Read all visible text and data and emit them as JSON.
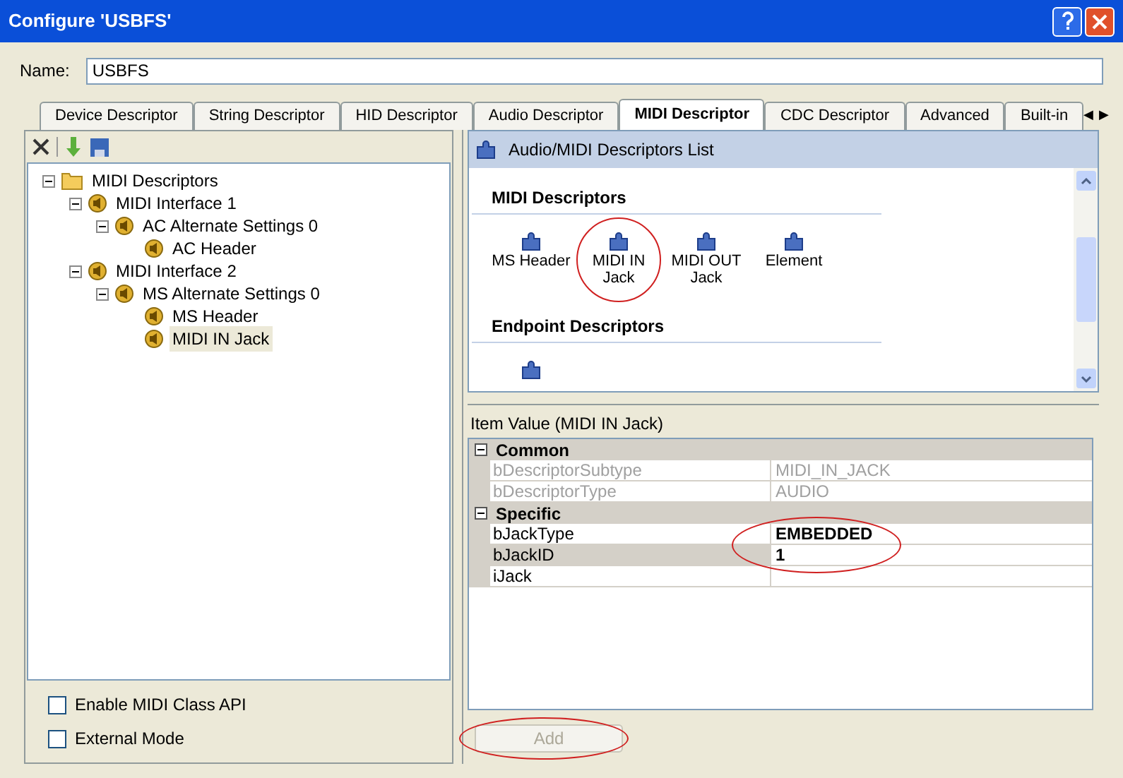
{
  "window": {
    "title": "Configure 'USBFS'"
  },
  "name_field": {
    "label": "Name:",
    "value": "USBFS"
  },
  "tabs": [
    {
      "label": "Device Descriptor",
      "selected": false
    },
    {
      "label": "String Descriptor",
      "selected": false
    },
    {
      "label": "HID Descriptor",
      "selected": false
    },
    {
      "label": "Audio Descriptor",
      "selected": false
    },
    {
      "label": "MIDI Descriptor",
      "selected": true
    },
    {
      "label": "CDC Descriptor",
      "selected": false
    },
    {
      "label": "Advanced",
      "selected": false
    },
    {
      "label": "Built-in",
      "selected": false
    }
  ],
  "tab_scroll": {
    "left": "◀",
    "right": "▶"
  },
  "tree": [
    {
      "label": "MIDI Descriptors",
      "kind": "folder",
      "expanded": true,
      "selected": false,
      "children": [
        {
          "label": "MIDI Interface 1",
          "kind": "node",
          "expanded": true,
          "selected": false,
          "children": [
            {
              "label": "AC Alternate Settings 0",
              "kind": "node",
              "expanded": true,
              "selected": false,
              "children": [
                {
                  "label": "AC Header",
                  "kind": "node",
                  "selected": false
                }
              ]
            }
          ]
        },
        {
          "label": "MIDI Interface 2",
          "kind": "node",
          "expanded": true,
          "selected": false,
          "children": [
            {
              "label": "MS Alternate Settings 0",
              "kind": "node",
              "expanded": true,
              "selected": false,
              "children": [
                {
                  "label": "MS Header",
                  "kind": "node",
                  "selected": false
                },
                {
                  "label": "MIDI IN Jack",
                  "kind": "node",
                  "selected": true
                }
              ]
            }
          ]
        }
      ]
    }
  ],
  "options": [
    {
      "label": "Enable MIDI Class API",
      "checked": false
    },
    {
      "label": "External Mode",
      "checked": false
    }
  ],
  "descriptor_list": {
    "title": "Audio/MIDI Descriptors List",
    "sections": [
      {
        "heading": "MIDI Descriptors",
        "items": [
          {
            "label": "MS Header",
            "circled": false
          },
          {
            "label": "MIDI IN Jack",
            "circled": true
          },
          {
            "label": "MIDI OUT Jack",
            "circled": false
          },
          {
            "label": "Element",
            "circled": false
          }
        ]
      },
      {
        "heading": "Endpoint Descriptors",
        "items": [
          {
            "circled": false
          }
        ]
      }
    ]
  },
  "item_value": {
    "title": "Item Value (MIDI IN Jack)",
    "rows": [
      {
        "kind": "category",
        "label": "Common",
        "expanded": true
      },
      {
        "kind": "property",
        "name": "bDescriptorSubtype",
        "value": "MIDI_IN_JACK",
        "disabled": true,
        "selected": false,
        "circled": false
      },
      {
        "kind": "property",
        "name": "bDescriptorType",
        "value": "AUDIO",
        "disabled": true,
        "selected": false,
        "circled": false
      },
      {
        "kind": "category",
        "label": "Specific",
        "expanded": true
      },
      {
        "kind": "property",
        "name": "bJackType",
        "value": "EMBEDDED",
        "disabled": false,
        "selected": false,
        "circled": true
      },
      {
        "kind": "property",
        "name": "bJackID",
        "value": "1",
        "disabled": false,
        "selected": true,
        "circled": true
      },
      {
        "kind": "property",
        "name": "iJack",
        "disabled": false,
        "selected": false,
        "circled": false
      }
    ]
  },
  "add_button": {
    "label": "Add",
    "disabled": true,
    "circled": true
  }
}
